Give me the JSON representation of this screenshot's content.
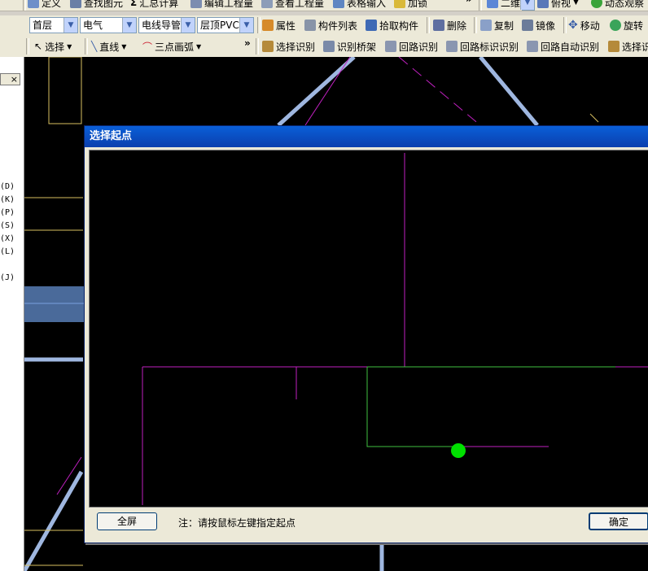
{
  "toolbar_top": {
    "items": [
      "定义",
      "查找图元",
      "汇总计算",
      "编辑工程量",
      "查看工程量",
      "表格输入",
      "加锁"
    ],
    "right_items": [
      "二维",
      "俯视",
      "动态观察"
    ],
    "more": "»"
  },
  "toolbar_mid": {
    "floor_value": "首层",
    "discipline_value": "电气",
    "type_value": "电线导管",
    "component_value": "层顶PVC3",
    "buttons": [
      "属性",
      "构件列表",
      "拾取构件",
      "删除",
      "复制",
      "镜像",
      "移动",
      "旋转"
    ]
  },
  "toolbar_low": {
    "draw_buttons": [
      "选择",
      "直线",
      "三点画弧"
    ],
    "more": "»",
    "recog_buttons": [
      "选择识别",
      "识别桥架",
      "回路识别",
      "回路标识识别",
      "回路自动识别",
      "选择识"
    ]
  },
  "left_panel": {
    "close_label": "×",
    "hotkeys": [
      "(D)",
      "(K)",
      "(P)",
      "(S)",
      "(X)",
      "(L)",
      "(J)"
    ]
  },
  "dialog": {
    "title": "选择起点",
    "fullscreen_label": "全屏",
    "note": "注：请按鼠标左键指定起点",
    "ok_label": "确定"
  },
  "colors": {
    "cad_background": "#000000",
    "magenta_line": "#c020c0",
    "green_line": "#40c040",
    "start_point": "#00e000",
    "title_bar": "#0b4fc7"
  }
}
